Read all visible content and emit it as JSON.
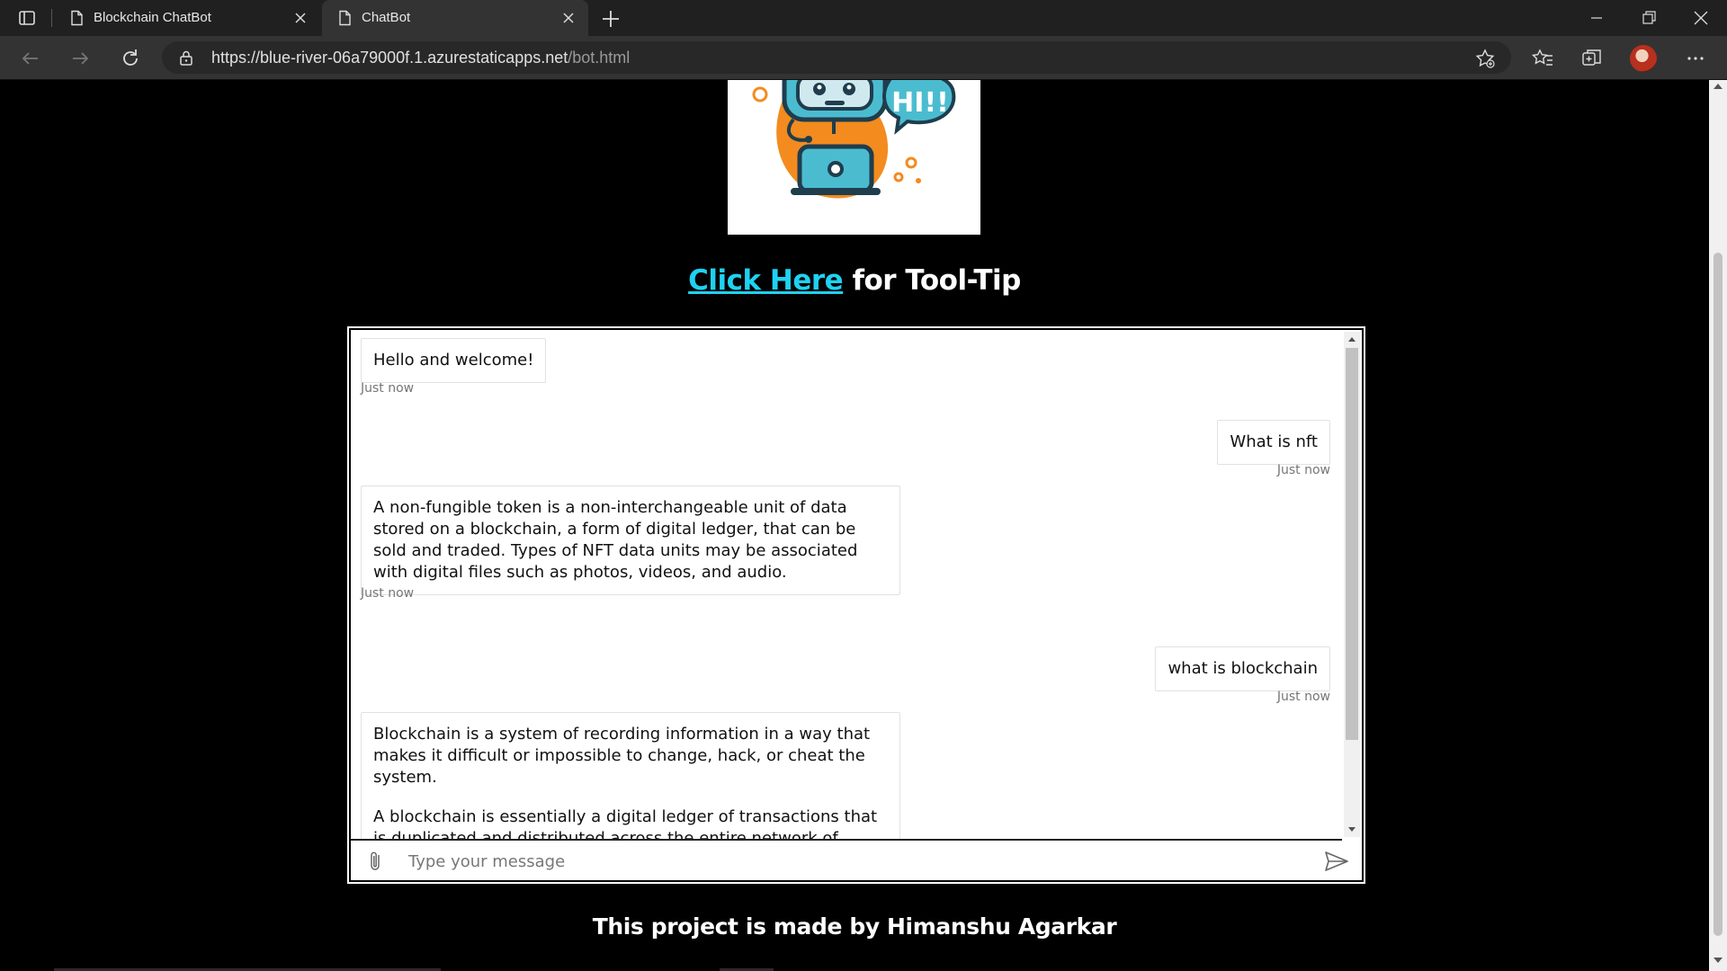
{
  "browser": {
    "tabs": [
      {
        "title": "Blockchain ChatBot",
        "active": false
      },
      {
        "title": "ChatBot",
        "active": true
      }
    ],
    "url": {
      "host": "https://blue-river-06a79000f.1.azurestaticapps.net",
      "path": "/bot.html"
    }
  },
  "page": {
    "bot_image": {
      "speech_text": "HI!!"
    },
    "tooltip": {
      "link_text": "Click Here",
      "rest_text": " for Tool-Tip"
    },
    "chat": {
      "messages": [
        {
          "from": "bot",
          "paragraphs": [
            "Hello and welcome!"
          ],
          "time": "Just now"
        },
        {
          "from": "user",
          "paragraphs": [
            "What is nft"
          ],
          "time": "Just now"
        },
        {
          "from": "bot",
          "paragraphs": [
            "A non-fungible token is a non-interchangeable unit of data stored on a blockchain, a form of digital ledger, that can be sold and traded. Types of NFT data units may be associated with digital files such as photos, videos, and audio."
          ],
          "time": "Just now"
        },
        {
          "from": "user",
          "paragraphs": [
            "what is blockchain"
          ],
          "time": "Just now"
        },
        {
          "from": "bot",
          "paragraphs": [
            "Blockchain is a system of recording information in a way that makes it difficult or impossible to change, hack, or cheat the system.",
            "A blockchain is essentially a digital ledger of transactions that is duplicated and distributed across the entire network of computer"
          ],
          "time": ""
        }
      ],
      "input_placeholder": "Type your message"
    },
    "footer": "This project is made by Himanshu Agarkar"
  },
  "colors": {
    "link": "#1fd1f2",
    "page_bg": "#000000",
    "chrome_bg": "#202020",
    "toolbar_bg": "#333333"
  }
}
